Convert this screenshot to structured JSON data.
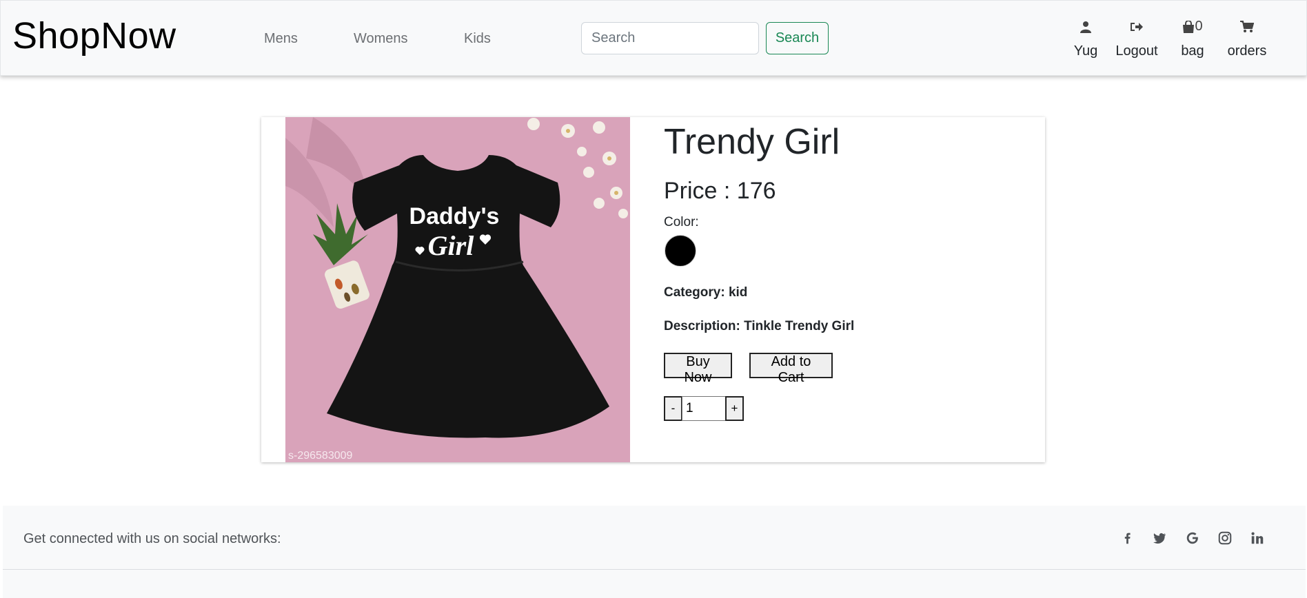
{
  "nav": {
    "brand": "ShopNow",
    "links": [
      "Mens",
      "Womens",
      "Kids"
    ],
    "search_placeholder": "Search",
    "search_button": "Search",
    "user": {
      "label": "Yug",
      "icon": "user-icon"
    },
    "logout": {
      "label": "Logout",
      "icon": "sign-out-icon"
    },
    "bag": {
      "label": "bag",
      "count": "0",
      "icon": "shopping-bag-icon"
    },
    "orders": {
      "label": "orders",
      "icon": "cart-icon"
    }
  },
  "product": {
    "title": "Trendy Girl",
    "price": "Price : 176",
    "color_label": "Color:",
    "color": "#000000",
    "category": "Category: kid",
    "description": "Description: Tinkle Trendy Girl",
    "buy_now": "Buy Now",
    "add_to_cart": "Add to Cart",
    "quantity": "1",
    "decrement": "-",
    "increment": "+",
    "image": {
      "print_line1": "Daddy's",
      "print_line2": "Girl",
      "watermark": "s-296583009",
      "background": "#d9a3ba"
    }
  },
  "footer": {
    "text": "Get connected with us on social networks:",
    "social": [
      "facebook-icon",
      "twitter-icon",
      "google-icon",
      "instagram-icon",
      "linkedin-icon"
    ]
  }
}
